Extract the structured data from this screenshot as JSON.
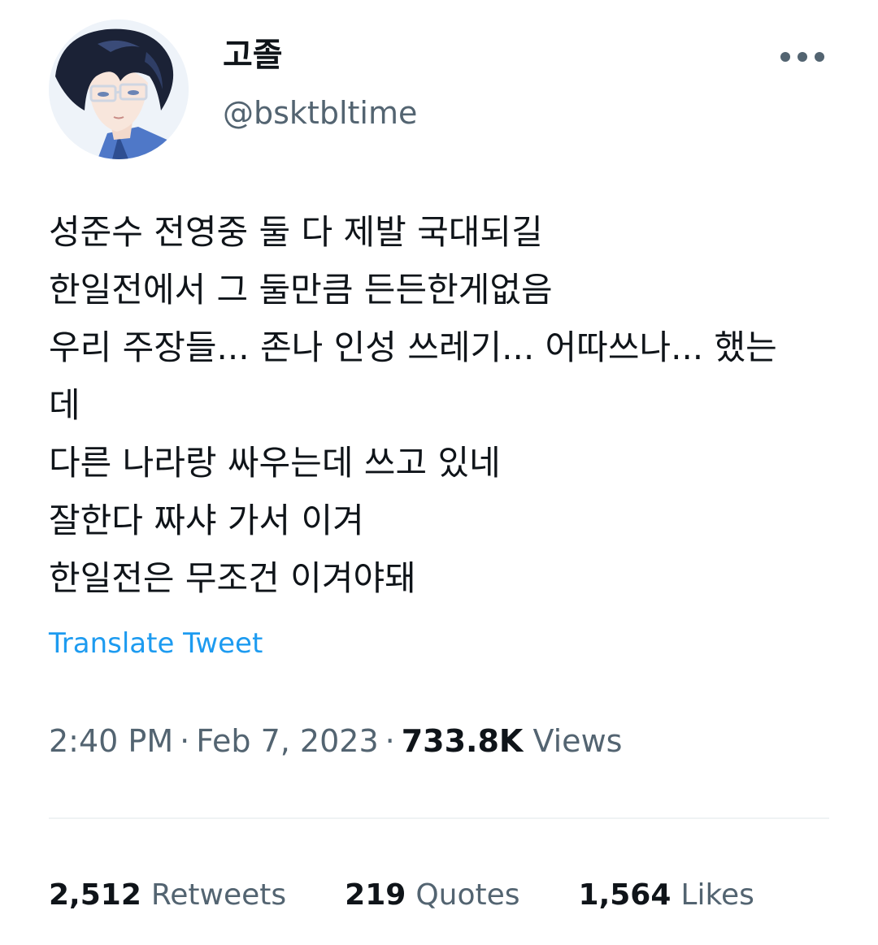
{
  "author": {
    "display_name": "고졸",
    "handle": "@bsktbltime",
    "avatar_icon": "anime-character-avatar"
  },
  "menu": {
    "icon": "more-horizontal-icon"
  },
  "tweet": {
    "lines": [
      "성준수 전영중 둘 다 제발 국대되길",
      "한일전에서 그 둘만큼 든든한게없음",
      "우리 주장들... 존나 인성 쓰레기... 어따쓰나... 했는",
      "데",
      "다른 나라랑 싸우는데 쓰고 있네",
      "잘한다 짜샤 가서 이겨",
      "한일전은 무조건 이겨야돼"
    ],
    "translate_label": "Translate Tweet"
  },
  "meta": {
    "time": "2:40 PM",
    "separator": "·",
    "date": "Feb 7, 2023",
    "views_count": "733.8K",
    "views_label": "Views"
  },
  "stats": {
    "retweets_count": "2,512",
    "retweets_label": "Retweets",
    "quotes_count": "219",
    "quotes_label": "Quotes",
    "likes_count": "1,564",
    "likes_label": "Likes"
  },
  "colors": {
    "text_primary": "#0f1419",
    "text_secondary": "#536471",
    "link": "#1d9bf0",
    "divider": "#eff3f4"
  }
}
